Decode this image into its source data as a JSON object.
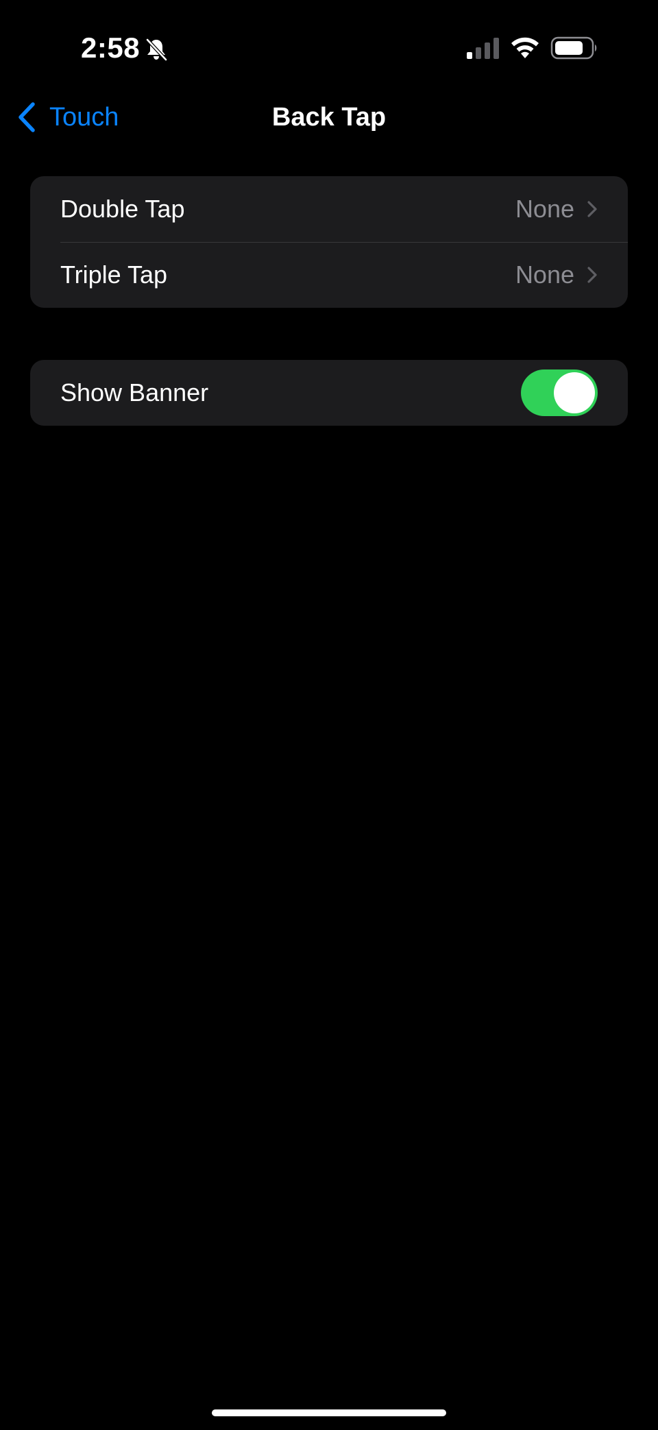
{
  "status_bar": {
    "time": "2:58",
    "silent_icon": "bell-slash-icon",
    "signal_icon": "cellular-signal-icon",
    "wifi_icon": "wifi-icon",
    "battery_icon": "battery-icon"
  },
  "nav": {
    "back_label": "Touch",
    "title": "Back Tap"
  },
  "tap_actions": [
    {
      "label": "Double Tap",
      "value": "None"
    },
    {
      "label": "Triple Tap",
      "value": "None"
    }
  ],
  "banner": {
    "label": "Show Banner",
    "enabled": true
  },
  "colors": {
    "accent": "#0a84ff",
    "toggle_on": "#30d158",
    "group_background": "#1c1c1e",
    "secondary_text": "#8d8d93"
  }
}
